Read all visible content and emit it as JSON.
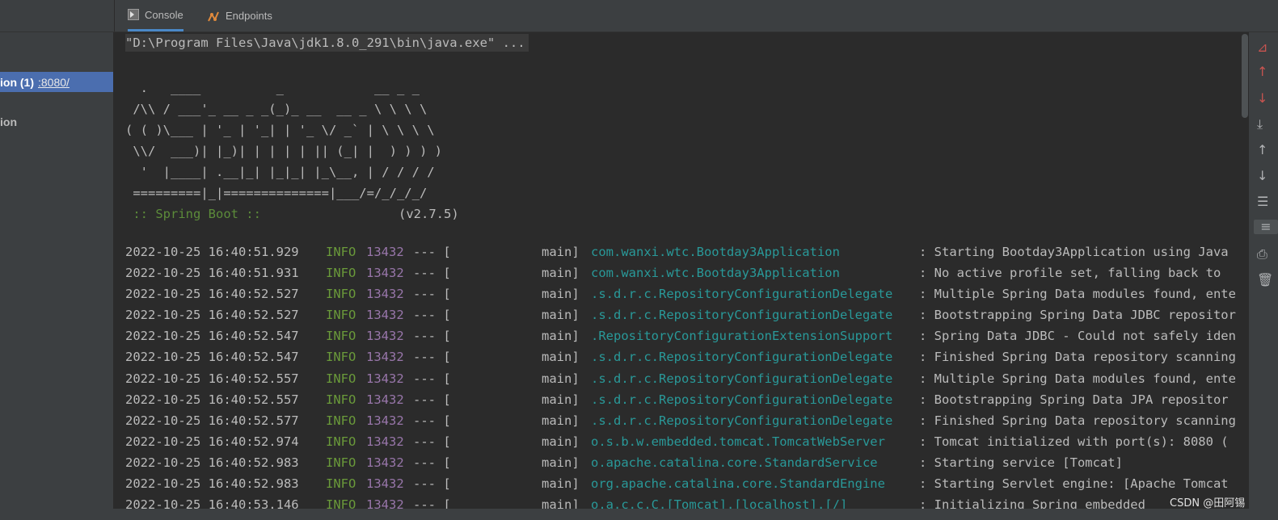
{
  "tabs": [
    {
      "label": "Console",
      "icon": "console-icon"
    },
    {
      "label": "Endpoints",
      "icon": "endpoints-icon"
    }
  ],
  "sidebar": {
    "items": [
      {
        "label": "ion (1)",
        "port": ":8080/",
        "selected": true
      },
      {
        "label": "ion",
        "selected": false
      }
    ]
  },
  "console": {
    "command": "\"D:\\Program Files\\Java\\jdk1.8.0_291\\bin\\java.exe\" ...",
    "banner": [
      "  .   ____          _            __ _ _",
      " /\\\\ / ___'_ __ _ _(_)_ __  __ _ \\ \\ \\ \\",
      "( ( )\\___ | '_ | '_| | '_ \\/ _` | \\ \\ \\ \\",
      " \\\\/  ___)| |_)| | | | | || (_| |  ) ) ) )",
      "  '  |____| .__|_| |_|_| |_\\__, | / / / /",
      " =========|_|==============|___/=/_/_/_/"
    ],
    "boot_label": " :: Spring Boot ::",
    "boot_version": "(v2.7.5)",
    "logs": [
      {
        "ts": "2022-10-25 16:40:51.929",
        "level": "INFO",
        "pid": "13432",
        "sep": "--- [",
        "thread": "main]",
        "logger": "com.wanxi.wtc.Bootday3Application",
        "msg": ": Starting Bootday3Application using Java"
      },
      {
        "ts": "2022-10-25 16:40:51.931",
        "level": "INFO",
        "pid": "13432",
        "sep": "--- [",
        "thread": "main]",
        "logger": "com.wanxi.wtc.Bootday3Application",
        "msg": ": No active profile set, falling back to"
      },
      {
        "ts": "2022-10-25 16:40:52.527",
        "level": "INFO",
        "pid": "13432",
        "sep": "--- [",
        "thread": "main]",
        "logger": ".s.d.r.c.RepositoryConfigurationDelegate",
        "msg": ": Multiple Spring Data modules found, ente"
      },
      {
        "ts": "2022-10-25 16:40:52.527",
        "level": "INFO",
        "pid": "13432",
        "sep": "--- [",
        "thread": "main]",
        "logger": ".s.d.r.c.RepositoryConfigurationDelegate",
        "msg": ": Bootstrapping Spring Data JDBC repositor"
      },
      {
        "ts": "2022-10-25 16:40:52.547",
        "level": "INFO",
        "pid": "13432",
        "sep": "--- [",
        "thread": "main]",
        "logger": ".RepositoryConfigurationExtensionSupport",
        "msg": ": Spring Data JDBC - Could not safely iden"
      },
      {
        "ts": "2022-10-25 16:40:52.547",
        "level": "INFO",
        "pid": "13432",
        "sep": "--- [",
        "thread": "main]",
        "logger": ".s.d.r.c.RepositoryConfigurationDelegate",
        "msg": ": Finished Spring Data repository scanning"
      },
      {
        "ts": "2022-10-25 16:40:52.557",
        "level": "INFO",
        "pid": "13432",
        "sep": "--- [",
        "thread": "main]",
        "logger": ".s.d.r.c.RepositoryConfigurationDelegate",
        "msg": ": Multiple Spring Data modules found, ente"
      },
      {
        "ts": "2022-10-25 16:40:52.557",
        "level": "INFO",
        "pid": "13432",
        "sep": "--- [",
        "thread": "main]",
        "logger": ".s.d.r.c.RepositoryConfigurationDelegate",
        "msg": ": Bootstrapping Spring Data JPA repositor"
      },
      {
        "ts": "2022-10-25 16:40:52.577",
        "level": "INFO",
        "pid": "13432",
        "sep": "--- [",
        "thread": "main]",
        "logger": ".s.d.r.c.RepositoryConfigurationDelegate",
        "msg": ": Finished Spring Data repository scanning"
      },
      {
        "ts": "2022-10-25 16:40:52.974",
        "level": "INFO",
        "pid": "13432",
        "sep": "--- [",
        "thread": "main]",
        "logger": "o.s.b.w.embedded.tomcat.TomcatWebServer",
        "msg": ": Tomcat initialized with port(s): 8080 ("
      },
      {
        "ts": "2022-10-25 16:40:52.983",
        "level": "INFO",
        "pid": "13432",
        "sep": "--- [",
        "thread": "main]",
        "logger": "o.apache.catalina.core.StandardService",
        "msg": ": Starting service [Tomcat]"
      },
      {
        "ts": "2022-10-25 16:40:52.983",
        "level": "INFO",
        "pid": "13432",
        "sep": "--- [",
        "thread": "main]",
        "logger": "org.apache.catalina.core.StandardEngine",
        "msg": ": Starting Servlet engine: [Apache Tomcat"
      },
      {
        "ts": "2022-10-25 16:40:53.146",
        "level": "INFO",
        "pid": "13432",
        "sep": "--- [",
        "thread": "main]",
        "logger": "o.a.c.c.C.[Tomcat].[localhost].[/]",
        "msg": ": Initializing Spring embedded"
      }
    ]
  },
  "watermark": "CSDN @田阿锡",
  "colors": {
    "accent": "#4b6eaf",
    "info": "#6a9a3a",
    "pid": "#9876aa",
    "logger": "#299999",
    "background": "#2b2b2b"
  }
}
